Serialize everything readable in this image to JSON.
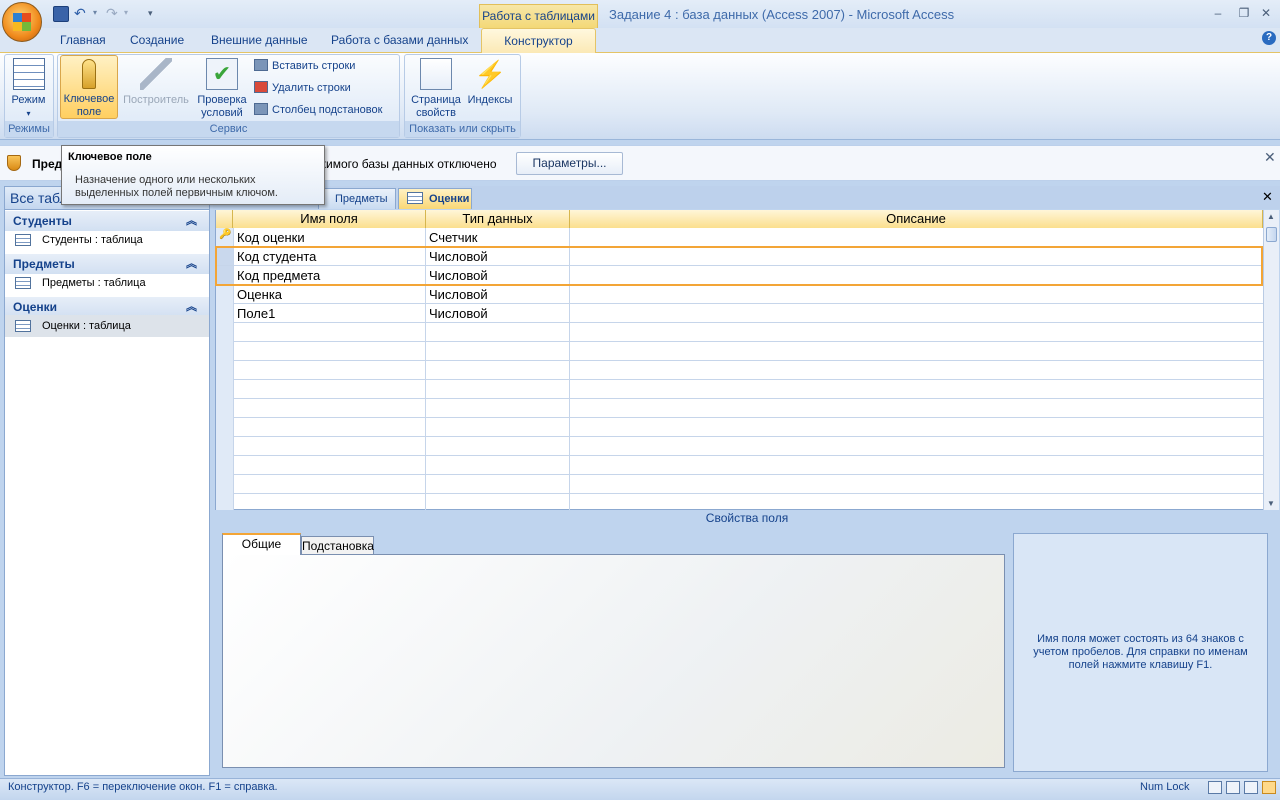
{
  "title_bar": {
    "contextual_tab_group": "Работа с таблицами",
    "window_title": "Задание 4 : база данных (Access 2007) - Microsoft Access"
  },
  "ribbon_tabs": [
    "Главная",
    "Создание",
    "Внешние данные",
    "Работа с базами данных",
    "Конструктор"
  ],
  "ribbon": {
    "groups": {
      "modes": "Режимы",
      "service": "Сервис",
      "show_hide": "Показать или скрыть"
    },
    "buttons": {
      "mode_line1": "Режим",
      "key_line1": "Ключевое",
      "key_line2": "поле",
      "builder": "Построитель",
      "check_line1": "Проверка",
      "check_line2": "условий",
      "insert_rows": "Вставить строки",
      "delete_rows": "Удалить строки",
      "lookup_col": "Столбец  подстановок",
      "page_line1": "Страница",
      "page_line2": "свойств",
      "indexes": "Индексы"
    }
  },
  "message_bar": {
    "text_start": "Пред",
    "text_end": "жимого базы данных отключено",
    "params_button": "Параметры..."
  },
  "tooltip": {
    "title": "Ключевое поле",
    "body": "Назначение одного или нескольких выделенных полей первичным ключом."
  },
  "nav_pane": {
    "header": "Все табл",
    "groups": [
      {
        "name": "Студенты",
        "item": "Студенты : таблица"
      },
      {
        "name": "Предметы",
        "item": "Предметы : таблица"
      },
      {
        "name": "Оценки",
        "item": "Оценки : таблица"
      }
    ]
  },
  "doc_tabs": [
    "Предметы",
    "Оценки"
  ],
  "grid": {
    "headers": [
      "Имя поля",
      "Тип данных",
      "Описание"
    ],
    "rows": [
      {
        "name": "Код оценки",
        "type": "Счетчик",
        "desc": ""
      },
      {
        "name": "Код студента",
        "type": "Числовой",
        "desc": ""
      },
      {
        "name": "Код предмета",
        "type": "Числовой",
        "desc": ""
      },
      {
        "name": "Оценка",
        "type": "Числовой",
        "desc": ""
      },
      {
        "name": "Поле1",
        "type": "Числовой",
        "desc": ""
      }
    ]
  },
  "field_props": {
    "title": "Свойства поля",
    "tab_general": "Общие",
    "tab_lookup": "Подстановка",
    "help_text": "Имя поля может состоять из 64 знаков с учетом пробелов.  Для справки по именам полей нажмите клавишу F1."
  },
  "status_bar": {
    "left": "Конструктор.  F6 = переключение окон.  F1 = справка.",
    "numlock": "Num Lock"
  },
  "colors": {
    "accent_orange": "#f3a536",
    "ribbon_blue": "#15428b"
  }
}
